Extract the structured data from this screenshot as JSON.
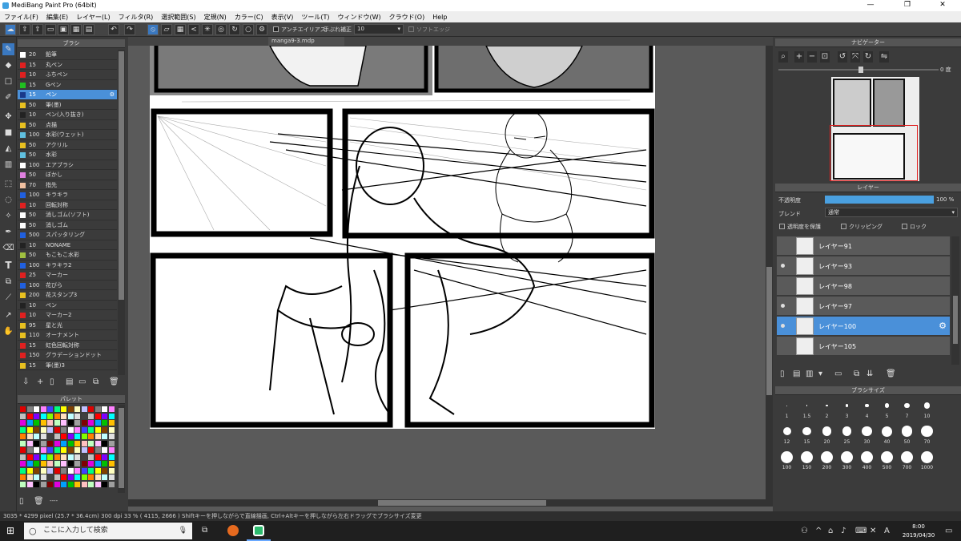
{
  "window": {
    "title": "MediBang Paint Pro (64bit)",
    "min": "—",
    "max": "❐",
    "close": "✕"
  },
  "menu": [
    "ファイル(F)",
    "編集(E)",
    "レイヤー(L)",
    "フィルタ(R)",
    "選択範囲(S)",
    "定規(N)",
    "カラー(C)",
    "表示(V)",
    "ツール(T)",
    "ウィンドウ(W)",
    "クラウド(O)",
    "Help"
  ],
  "toolbar": {
    "antialias_label": "アンチエイリアス",
    "stabilizer_label": "手ぶれ補正",
    "stabilizer_value": "10",
    "soft_edge_label": "ソフトエッジ"
  },
  "brush_panel": {
    "title": "ブラシ",
    "items": [
      {
        "size": "20",
        "name": "鉛筆",
        "color": "#ffffff"
      },
      {
        "size": "15",
        "name": "丸ペン",
        "color": "#e02020"
      },
      {
        "size": "10",
        "name": "ふちペン",
        "color": "#e02020"
      },
      {
        "size": "15",
        "name": "Gペン",
        "color": "#20c020"
      },
      {
        "size": "15",
        "name": "ペン",
        "color": "#1a3a8a"
      },
      {
        "size": "50",
        "name": "筆(墨)",
        "color": "#e8c020"
      },
      {
        "size": "10",
        "name": "ペン(入り抜き)",
        "color": "#222222"
      },
      {
        "size": "50",
        "name": "点描",
        "color": "#e8c020"
      },
      {
        "size": "100",
        "name": "水彩(ウェット)",
        "color": "#60c0e0"
      },
      {
        "size": "50",
        "name": "アクリル",
        "color": "#e8c020"
      },
      {
        "size": "50",
        "name": "水彩",
        "color": "#60c0e0"
      },
      {
        "size": "100",
        "name": "エアブラシ",
        "color": "#ffffff"
      },
      {
        "size": "50",
        "name": "ぼかし",
        "color": "#e080e0"
      },
      {
        "size": "70",
        "name": "指先",
        "color": "#f0c0a0"
      },
      {
        "size": "100",
        "name": "キラキラ",
        "color": "#2060e0"
      },
      {
        "size": "10",
        "name": "回転対称",
        "color": "#e02020"
      },
      {
        "size": "50",
        "name": "消しゴム(ソフト)",
        "color": "#ffffff"
      },
      {
        "size": "50",
        "name": "消しゴム",
        "color": "#ffffff"
      },
      {
        "size": "500",
        "name": "スパッタリング",
        "color": "#2060e0"
      },
      {
        "size": "10",
        "name": "NONAME",
        "color": "#222222"
      },
      {
        "size": "50",
        "name": "もこもこ水彩",
        "color": "#a0c040"
      },
      {
        "size": "100",
        "name": "キラキラ2",
        "color": "#2060e0"
      },
      {
        "size": "25",
        "name": "マーカー",
        "color": "#e02020"
      },
      {
        "size": "100",
        "name": "花びら",
        "color": "#2060e0"
      },
      {
        "size": "200",
        "name": "花スタンプ3",
        "color": "#e8c020"
      },
      {
        "size": "10",
        "name": "ペン",
        "color": "#222222"
      },
      {
        "size": "10",
        "name": "マーカー2",
        "color": "#e02020"
      },
      {
        "size": "95",
        "name": "星と光",
        "color": "#e8c020"
      },
      {
        "size": "110",
        "name": "オーナメント",
        "color": "#e8c020"
      },
      {
        "size": "15",
        "name": "虹色回転対称",
        "color": "#e02020"
      },
      {
        "size": "150",
        "name": "グラデーションドット",
        "color": "#e02020"
      },
      {
        "size": "15",
        "name": "筆(墨)3",
        "color": "#e8c020"
      }
    ]
  },
  "palette_panel": {
    "title": "パレット",
    "footer": "----"
  },
  "document": {
    "tab_name": "manga9-3.mdp"
  },
  "navigator": {
    "title": "ナビゲーター",
    "angle": "0 度"
  },
  "layer_panel": {
    "title": "レイヤー",
    "opacity_label": "不透明度",
    "opacity_value": "100 %",
    "opacity_fraction": 1.0,
    "blend_label": "ブレンド",
    "blend_value": "通常",
    "protect_label": "透明度を保護",
    "clipping_label": "クリッピング",
    "lock_label": "ロック",
    "layers": [
      {
        "name": "レイヤー91",
        "visible": false
      },
      {
        "name": "レイヤー93",
        "visible": true
      },
      {
        "name": "レイヤー98",
        "visible": false
      },
      {
        "name": "レイヤー97",
        "visible": true
      },
      {
        "name": "レイヤー100",
        "visible": true,
        "selected": true
      },
      {
        "name": "レイヤー105",
        "visible": false
      }
    ]
  },
  "brush_size_panel": {
    "title": "ブラシサイズ",
    "sizes": [
      "1",
      "1.5",
      "2",
      "3",
      "4",
      "5",
      "7",
      "10",
      "12",
      "15",
      "20",
      "25",
      "30",
      "40",
      "50",
      "70",
      "100",
      "150",
      "200",
      "300",
      "400",
      "500",
      "700",
      "1000"
    ]
  },
  "status": {
    "dimensions": "3035 * 4299 pixel",
    "physical": "(25.7 * 36.4cm)",
    "dpi": "300 dpi",
    "zoom": "33 %",
    "coords": "( 4115, 2666 )",
    "hint": "Shiftキーを押しながらで直線描画, Ctrl+Altキーを押しながら左右ドラッグでブラシサイズ変更"
  },
  "taskbar": {
    "search_placeholder": "ここに入力して検索",
    "time": "8:00",
    "date": "2019/04/30"
  }
}
